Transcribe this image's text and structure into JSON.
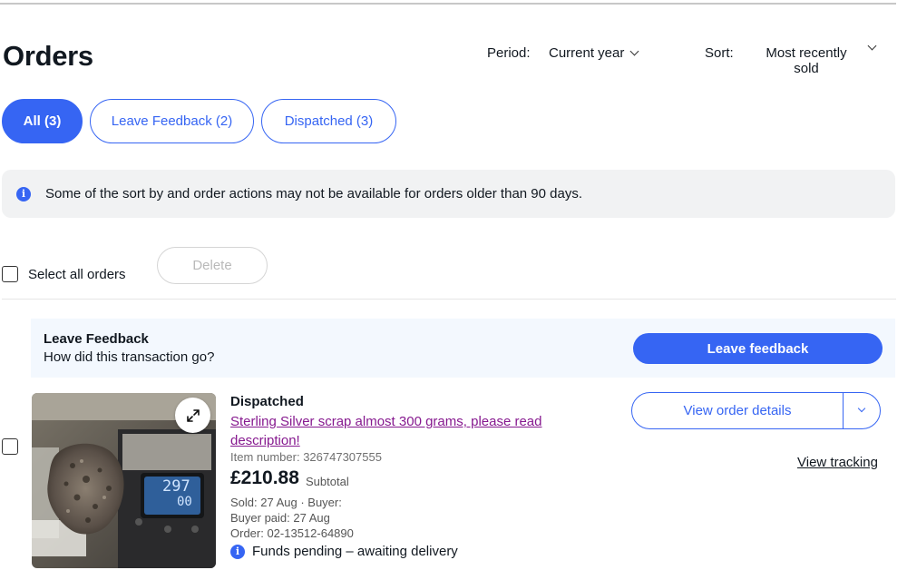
{
  "header": {
    "title": "Orders",
    "period_label": "Period:",
    "period_value": "Current year",
    "sort_label": "Sort:",
    "sort_value": "Most recently sold"
  },
  "tabs": [
    {
      "label": "All (3)",
      "active": true
    },
    {
      "label": "Leave Feedback (2)",
      "active": false
    },
    {
      "label": "Dispatched (3)",
      "active": false
    }
  ],
  "info_banner": {
    "text": "Some of the sort by and order actions may not be available for orders older than 90 days."
  },
  "bulk_actions": {
    "select_all_label": "Select all orders",
    "delete_label": "Delete"
  },
  "feedback_prompt": {
    "title": "Leave Feedback",
    "subtitle": "How did this transaction go?",
    "button_label": "Leave feedback"
  },
  "order": {
    "status": "Dispatched",
    "item_title": "Sterling Silver scrap almost 300 grams, please read description!",
    "item_number": "Item number: 326747307555",
    "price": "£210.88",
    "price_note": "Subtotal",
    "sold": "Sold: 27 Aug · Buyer:",
    "buyer_paid": "Buyer paid: 27 Aug",
    "order_number": "Order: 02-13512-64890",
    "funds_status": "Funds pending – awaiting delivery",
    "scale_reading_top": "297",
    "scale_reading_bottom": "00",
    "view_order_label": "View order details",
    "view_tracking_label": "View tracking"
  },
  "colors": {
    "accent": "#3665f3",
    "link_visited": "#86198f",
    "banner_bg": "#f1f2f3",
    "feedback_bg": "#f3f8fe"
  },
  "icons": [
    "info-icon",
    "expand-icon",
    "chevron-down-icon"
  ]
}
